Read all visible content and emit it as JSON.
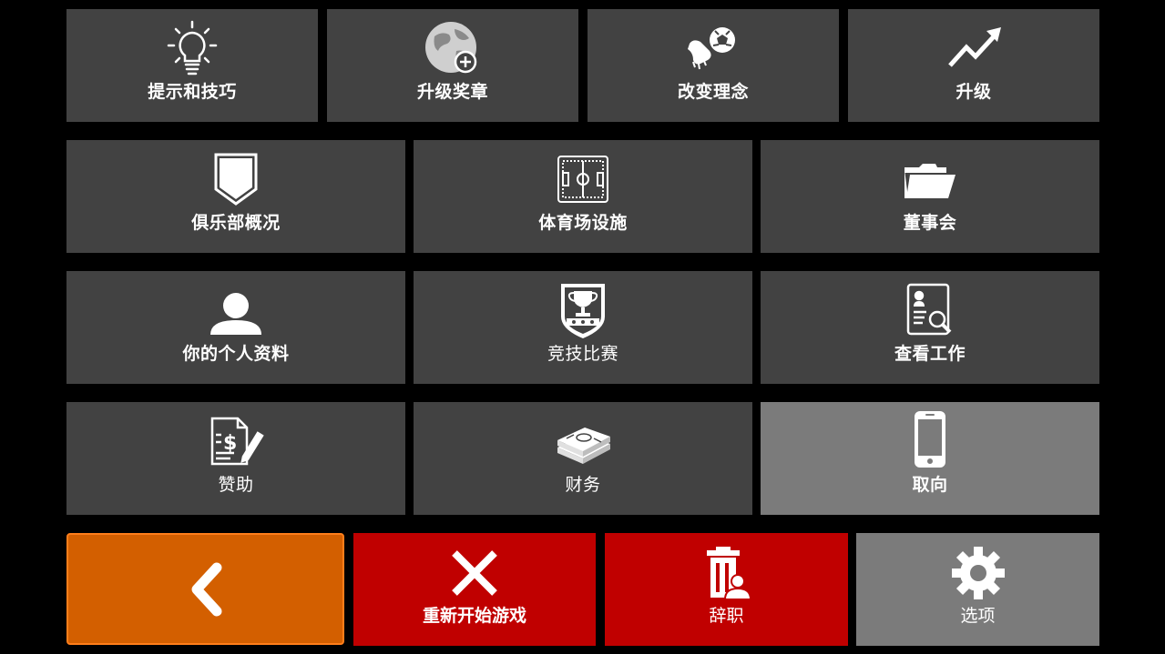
{
  "row1": [
    {
      "label": "提示和技巧",
      "icon": "lightbulb-icon"
    },
    {
      "label": "升级奖章",
      "icon": "globe-plus-icon"
    },
    {
      "label": "改变理念",
      "icon": "boot-ball-icon"
    },
    {
      "label": "升级",
      "icon": "trend-up-icon"
    }
  ],
  "row2": [
    {
      "label": "俱乐部概况",
      "icon": "shield-icon"
    },
    {
      "label": "体育场设施",
      "icon": "pitch-icon"
    },
    {
      "label": "董事会",
      "icon": "folder-icon"
    }
  ],
  "row3": [
    {
      "label": "你的个人资料",
      "icon": "person-icon"
    },
    {
      "label": "竞技比赛",
      "icon": "trophy-badge-icon"
    },
    {
      "label": "查看工作",
      "icon": "job-search-icon"
    }
  ],
  "row4": [
    {
      "label": "赞助",
      "icon": "contract-icon"
    },
    {
      "label": "财务",
      "icon": "money-stack-icon"
    },
    {
      "label": "取向",
      "icon": "phone-icon"
    }
  ],
  "bottom": {
    "back_icon": "chevron-left-icon",
    "restart": {
      "label": "重新开始游戏",
      "icon": "close-icon"
    },
    "resign": {
      "label": "辞职",
      "icon": "trash-person-icon"
    },
    "options": {
      "label": "选项",
      "icon": "gear-icon"
    }
  },
  "colors": {
    "tile": "#424242",
    "highlight": "#7b7b7b",
    "back": "#d35f00",
    "red": "#c00000",
    "background": "#000000"
  }
}
